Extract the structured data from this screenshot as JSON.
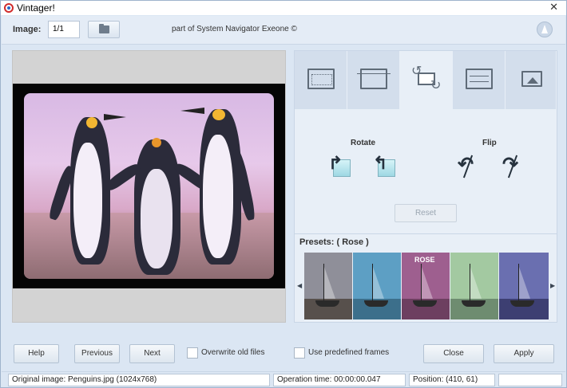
{
  "window": {
    "title": "Vintager!"
  },
  "toolbar": {
    "image_label": "Image:",
    "image_value": "1/1",
    "part_of": "part of System Navigator Exeone ©"
  },
  "tabs": [
    {
      "icon": "vignette-icon"
    },
    {
      "icon": "crop-icon"
    },
    {
      "icon": "rotate-image-icon",
      "active": true
    },
    {
      "icon": "adjust-sliders-icon"
    },
    {
      "icon": "resize-icon"
    }
  ],
  "rotate_section": {
    "title": "Rotate"
  },
  "flip_section": {
    "title": "Flip"
  },
  "reset_label": "Reset",
  "presets": {
    "title": "Presets: ( Rose )",
    "selected_label": "ROSE",
    "items": [
      {
        "sky": "#8f8f99",
        "sea": "#57504c"
      },
      {
        "sky": "#5d9fc4",
        "sea": "#3c6f8b"
      },
      {
        "sky": "#9e5f8f",
        "sea": "#6d3f60"
      },
      {
        "sky": "#a3c9a1",
        "sea": "#6e8c70"
      },
      {
        "sky": "#6a6fb0",
        "sea": "#3d3f72"
      }
    ]
  },
  "buttons": {
    "help": "Help",
    "previous": "Previous",
    "next": "Next",
    "close": "Close",
    "apply": "Apply"
  },
  "options": {
    "overwrite": "Overwrite old files",
    "predefined_frames": "Use predefined frames"
  },
  "status": {
    "original": "Original image: Penguins.jpg (1024x768)",
    "operation_time": "Operation time: 00:00:00.047",
    "position": "Position: (410, 61)",
    "extra": ""
  },
  "colors": {
    "accent": "#dbe6f3",
    "preview_bg": "#d3d3d3"
  }
}
